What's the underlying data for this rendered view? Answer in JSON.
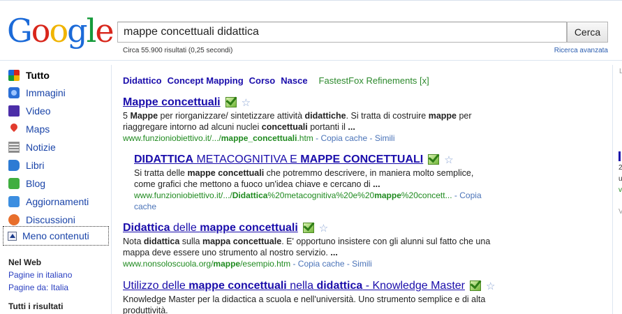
{
  "header": {
    "logo": [
      "G",
      "o",
      "o",
      "g",
      "l",
      "e"
    ],
    "query": "mappe concettuali didattica",
    "search_button": "Cerca",
    "stats": "Circa 55.900 risultati (0,25 secondi)",
    "advanced": "Ricerca avanzata"
  },
  "sidebar": {
    "items": [
      {
        "label": "Tutto",
        "icon": "all-icon"
      },
      {
        "label": "Immagini",
        "icon": "images-icon"
      },
      {
        "label": "Video",
        "icon": "video-icon"
      },
      {
        "label": "Maps",
        "icon": "map-pin-icon"
      },
      {
        "label": "Notizie",
        "icon": "news-icon"
      },
      {
        "label": "Libri",
        "icon": "books-icon"
      },
      {
        "label": "Blog",
        "icon": "blog-icon"
      },
      {
        "label": "Aggiornamenti",
        "icon": "updates-icon"
      },
      {
        "label": "Discussioni",
        "icon": "discussions-icon"
      }
    ],
    "less": "Meno contenuti",
    "web_head": "Nel Web",
    "web_links": [
      "Pagine in italiano",
      "Pagine da: Italia"
    ],
    "results_head": "Tutti i risultati"
  },
  "refinements": {
    "links": [
      "Didattico",
      "Concept Mapping",
      "Corso",
      "Nasce"
    ],
    "fastestfox": "FastestFox Refinements [x]"
  },
  "results": [
    {
      "title_parts": [
        [
          "b",
          "Mappe concettuali"
        ]
      ],
      "snippet_parts": [
        [
          "t",
          "5 "
        ],
        [
          "b",
          "Mappe"
        ],
        [
          "t",
          " per riorganizzare/ sintetizzare attività "
        ],
        [
          "b",
          "didattiche"
        ],
        [
          "t",
          ". Si tratta di costruire "
        ],
        [
          "b",
          "mappe"
        ],
        [
          "t",
          " per riaggregare intorno ad alcuni nuclei "
        ],
        [
          "b",
          "concettuali"
        ],
        [
          "t",
          " portanti il "
        ],
        [
          "b",
          "..."
        ]
      ],
      "url_parts": [
        [
          "t",
          "www.funzioniobiettivo.it/.../"
        ],
        [
          "b",
          "mappe_concettuali"
        ],
        [
          "t",
          ".htm"
        ]
      ],
      "links": " - Copia cache - Simili"
    },
    {
      "title_parts": [
        [
          "b",
          "DIDATTICA"
        ],
        [
          "t",
          " METACOGNITIVA E "
        ],
        [
          "b",
          "MAPPE CONCETTUALI"
        ]
      ],
      "snippet_parts": [
        [
          "t",
          "Si tratta delle "
        ],
        [
          "b",
          "mappe concettuali"
        ],
        [
          "t",
          " che potremmo descrivere, in maniera molto semplice, come grafici che mettono a fuoco un'idea chiave e cercano di "
        ],
        [
          "b",
          "..."
        ]
      ],
      "url_parts": [
        [
          "t",
          "www.funzioniobiettivo.it/.../"
        ],
        [
          "b",
          "Didattica"
        ],
        [
          "t",
          "%20metacognitiva%20e%20"
        ],
        [
          "b",
          "mappe"
        ],
        [
          "t",
          "%20concett..."
        ]
      ],
      "links": " - Copia cache"
    },
    {
      "title_parts": [
        [
          "b",
          "Didattica"
        ],
        [
          "t",
          " delle "
        ],
        [
          "b",
          "mappe concettuali"
        ]
      ],
      "snippet_parts": [
        [
          "t",
          "Nota "
        ],
        [
          "b",
          "didattica"
        ],
        [
          "t",
          " sulla "
        ],
        [
          "b",
          "mappa concettuale"
        ],
        [
          "t",
          ". E' opportuno insistere con gli alunni sul fatto che una mappa deve essere uno strumento al nostro servizio. "
        ],
        [
          "b",
          "..."
        ]
      ],
      "url_parts": [
        [
          "t",
          "www.nonsoloscuola.org/"
        ],
        [
          "b",
          "mappe"
        ],
        [
          "t",
          "/esempio.htm"
        ]
      ],
      "links": " - Copia cache - Simili"
    },
    {
      "title_parts": [
        [
          "t",
          "Utilizzo delle "
        ],
        [
          "b",
          "mappe concettuali"
        ],
        [
          "t",
          " nella "
        ],
        [
          "b",
          "didattica"
        ],
        [
          "t",
          " - Knowledge Master"
        ]
      ],
      "snippet_parts": [
        [
          "t",
          "Knowledge Master per la didactica a scuola e nell'università. Uno strumento semplice e di alta produttività."
        ]
      ],
      "url_parts": [],
      "links": ""
    }
  ],
  "right_col": {
    "l1": "L",
    "l2": "2",
    "l3": "u",
    "l4": "v",
    "l5": "V"
  },
  "colors": {
    "link": "#1a0dab",
    "url_green": "#1f8a1f",
    "nav_blue": "#1a44a8"
  }
}
